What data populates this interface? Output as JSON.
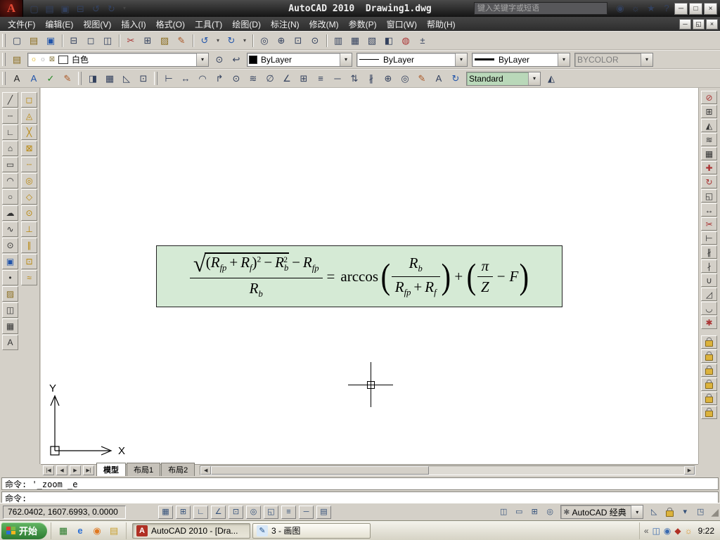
{
  "colors": {
    "titlebar_bg": "#2f2f2f",
    "toolbar_bg": "#d4d0c8",
    "canvas_bg": "#ffffff",
    "formula_bg": "#d5ead5",
    "textstyle_dropdown_bg": "#b9d8b9",
    "start_button_green": "#2c7a32",
    "autocad_logo_red": "#e24a35"
  },
  "ui": {
    "dd_arrow": "▾",
    "scroll_left": "◀",
    "scroll_right": "▶"
  },
  "titlebar": {
    "logo": "A",
    "title": "AutoCAD 2010  Drawing1.dwg",
    "search_placeholder": "键入关键字或短语",
    "quick_icons": [
      {
        "name": "qat-new-icon",
        "glyph": "▢"
      },
      {
        "name": "qat-open-icon",
        "glyph": "▤"
      },
      {
        "name": "qat-save-icon",
        "glyph": "▣"
      },
      {
        "name": "qat-plot-icon",
        "glyph": "⊟"
      },
      {
        "name": "qat-undo-icon",
        "glyph": "↺"
      },
      {
        "name": "qat-redo-icon",
        "glyph": "↻"
      },
      {
        "name": "qat-menu-dropdown",
        "glyph": "▾"
      }
    ],
    "search_icons": [
      {
        "name": "search-binoculars-icon",
        "glyph": "◉"
      },
      {
        "name": "communication-center-icon",
        "glyph": "☼"
      },
      {
        "name": "favorites-star-icon",
        "glyph": "★"
      },
      {
        "name": "help-menu-icon",
        "glyph": "?"
      }
    ],
    "window_buttons": [
      {
        "name": "app-minimize-button",
        "glyph": "─"
      },
      {
        "name": "app-maximize-button",
        "glyph": "□"
      },
      {
        "name": "app-close-button",
        "glyph": "×"
      }
    ]
  },
  "menubar": {
    "items": [
      "文件(F)",
      "编辑(E)",
      "视图(V)",
      "插入(I)",
      "格式(O)",
      "工具(T)",
      "绘图(D)",
      "标注(N)",
      "修改(M)",
      "参数(P)",
      "窗口(W)",
      "帮助(H)"
    ],
    "window_buttons": [
      {
        "name": "doc-minimize-button",
        "glyph": "─"
      },
      {
        "name": "doc-restore-button",
        "glyph": "◱"
      },
      {
        "name": "doc-close-button",
        "glyph": "×"
      }
    ]
  },
  "toolbars": {
    "standard": [
      {
        "name": "qnew-button",
        "glyph": "▢"
      },
      {
        "name": "open-button",
        "glyph": "▤",
        "c": "#8a6d1f"
      },
      {
        "name": "save-button",
        "glyph": "▣",
        "c": "#2255aa"
      },
      {
        "name": "separator",
        "type": "sep",
        "interactable": "false"
      },
      {
        "name": "plot-button",
        "glyph": "⊟"
      },
      {
        "name": "plot-preview-button",
        "glyph": "◻"
      },
      {
        "name": "publish-button",
        "glyph": "◫"
      },
      {
        "name": "separator",
        "type": "sep",
        "interactable": "false"
      },
      {
        "name": "cut-button",
        "glyph": "✂",
        "c": "#aa3333"
      },
      {
        "name": "copy-button",
        "glyph": "⊞"
      },
      {
        "name": "paste-button",
        "glyph": "▨",
        "c": "#8a6d1f"
      },
      {
        "name": "match-properties-button",
        "glyph": "✎",
        "c": "#aa5522"
      },
      {
        "name": "separator",
        "type": "sep",
        "interactable": "false"
      },
      {
        "name": "undo-button",
        "glyph": "↺",
        "c": "#2255aa"
      },
      {
        "name": "undo-dropdown",
        "glyph": "▾"
      },
      {
        "name": "redo-button",
        "glyph": "↻",
        "c": "#2255aa"
      },
      {
        "name": "redo-dropdown",
        "glyph": "▾"
      },
      {
        "name": "separator",
        "type": "sep",
        "interactable": "false"
      },
      {
        "name": "pan-button",
        "glyph": "◎"
      },
      {
        "name": "zoom-realtime-button",
        "glyph": "⊕"
      },
      {
        "name": "zoom-window-button",
        "glyph": "⊡"
      },
      {
        "name": "zoom-previous-button",
        "glyph": "⊙"
      },
      {
        "name": "separator",
        "type": "sep",
        "interactable": "false"
      },
      {
        "name": "properties-button",
        "glyph": "▥"
      },
      {
        "name": "designcenter-button",
        "glyph": "▦"
      },
      {
        "name": "tool-palettes-button",
        "glyph": "▧"
      },
      {
        "name": "sheet-set-manager-button",
        "glyph": "◧"
      },
      {
        "name": "markup-button",
        "glyph": "◍",
        "c": "#aa3333"
      },
      {
        "name": "quickcalc-button",
        "glyph": "±"
      }
    ],
    "layers_pre": [
      {
        "name": "layer-properties-manager-button",
        "glyph": "▤",
        "c": "#8a6d1f"
      }
    ],
    "layer_status": [
      {
        "name": "layer-on-icon",
        "glyph": "☼",
        "c": "#d8a800"
      },
      {
        "name": "layer-freeze-icon",
        "glyph": "☼",
        "c": "#999999"
      },
      {
        "name": "layer-lock-icon",
        "glyph": "⊠",
        "c": "#8a7a40"
      },
      {
        "name": "layer-color-chip",
        "type": "chip",
        "c": "#ffffff"
      }
    ],
    "layer_value": "白色",
    "layers_post": [
      {
        "name": "make-object-layer-current-button",
        "glyph": "⊙"
      },
      {
        "name": "layer-previous-button",
        "glyph": "↩"
      }
    ],
    "properties": {
      "color_chip": "#000000",
      "color_value": "ByLayer",
      "linetype_value": "ByLayer",
      "lineweight_value": "ByLayer",
      "plotstyle_value": "BYCOLOR"
    },
    "styles_icons": [
      {
        "name": "text-style-button",
        "glyph": "A",
        "c": "#222222"
      },
      {
        "name": "single-line-text-button",
        "glyph": "A",
        "c": "#2255aa"
      },
      {
        "name": "spell-check-button",
        "glyph": "✓",
        "c": "#228822"
      },
      {
        "name": "text-edit-button",
        "glyph": "✎",
        "c": "#aa5522"
      }
    ],
    "styles_icons2": [
      {
        "name": "dimension-style-button",
        "glyph": "◨"
      },
      {
        "name": "table-style-button",
        "glyph": "▦"
      },
      {
        "name": "multileader-style-button",
        "glyph": "◺"
      },
      {
        "name": "style-update-button",
        "glyph": "⊡"
      }
    ],
    "dim_icons": [
      {
        "name": "linear-dimension-button",
        "glyph": "⊢"
      },
      {
        "name": "aligned-dimension-button",
        "glyph": "↔"
      },
      {
        "name": "arc-length-button",
        "glyph": "◠"
      },
      {
        "name": "ordinate-button",
        "glyph": "↱"
      },
      {
        "name": "radius-button",
        "glyph": "⊙"
      },
      {
        "name": "jogged-button",
        "glyph": "≋"
      },
      {
        "name": "diameter-button",
        "glyph": "∅"
      },
      {
        "name": "angular-button",
        "glyph": "∠"
      },
      {
        "name": "quick-dimension-button",
        "glyph": "⊞"
      },
      {
        "name": "baseline-button",
        "glyph": "≡"
      },
      {
        "name": "continue-button",
        "glyph": "─"
      },
      {
        "name": "dim-space-button",
        "glyph": "⇅"
      },
      {
        "name": "dim-break-button",
        "glyph": "∦"
      },
      {
        "name": "tolerance-button",
        "glyph": "⊕"
      },
      {
        "name": "center-mark-button",
        "glyph": "◎"
      },
      {
        "name": "dim-edit-button",
        "glyph": "✎",
        "c": "#aa5522"
      },
      {
        "name": "dim-text-edit-button",
        "glyph": "A"
      },
      {
        "name": "dim-update-button",
        "glyph": "↻",
        "c": "#2255aa"
      }
    ],
    "textstyle_value": "Standard",
    "dim_post": [
      {
        "name": "dimension-style-manager-button",
        "glyph": "◭"
      }
    ]
  },
  "palettes": {
    "draw": [
      {
        "name": "line-button",
        "glyph": "╱"
      },
      {
        "name": "construction-line-button",
        "glyph": "┄"
      },
      {
        "name": "polyline-button",
        "glyph": "∟"
      },
      {
        "name": "polygon-button",
        "glyph": "⌂"
      },
      {
        "name": "rectangle-button",
        "glyph": "▭"
      },
      {
        "name": "arc-button",
        "glyph": "◠"
      },
      {
        "name": "circle-button",
        "glyph": "○"
      },
      {
        "name": "revision-cloud-button",
        "glyph": "☁"
      },
      {
        "name": "spline-button",
        "glyph": "∿"
      },
      {
        "name": "ellipse-button",
        "glyph": "⊙"
      },
      {
        "name": "insert-block-button",
        "glyph": "▣",
        "c": "#2255aa"
      },
      {
        "name": "point-button",
        "glyph": "•"
      },
      {
        "name": "hatch-button",
        "glyph": "▨",
        "c": "#8a6d1f"
      },
      {
        "name": "region-button",
        "glyph": "◫"
      },
      {
        "name": "table-button",
        "glyph": "▦"
      },
      {
        "name": "multiline-text-button",
        "glyph": "A"
      }
    ],
    "osnap": [
      {
        "name": "snap-to-endpoint-button",
        "glyph": "◻",
        "c": "#b8860b"
      },
      {
        "name": "snap-to-midpoint-button",
        "glyph": "◬",
        "c": "#b8860b"
      },
      {
        "name": "snap-to-intersection-button",
        "glyph": "╳",
        "c": "#b8860b"
      },
      {
        "name": "snap-to-apparent-intersection-button",
        "glyph": "⊠",
        "c": "#b8860b"
      },
      {
        "name": "snap-to-extension-button",
        "glyph": "┄",
        "c": "#b8860b"
      },
      {
        "name": "snap-to-center-button",
        "glyph": "◎",
        "c": "#b8860b"
      },
      {
        "name": "snap-to-quadrant-button",
        "glyph": "◇",
        "c": "#b8860b"
      },
      {
        "name": "snap-to-tangent-button",
        "glyph": "⊙",
        "c": "#b8860b"
      },
      {
        "name": "snap-to-perpendicular-button",
        "glyph": "⊥",
        "c": "#b8860b"
      },
      {
        "name": "snap-to-parallel-button",
        "glyph": "∥",
        "c": "#b8860b"
      },
      {
        "name": "snap-to-node-button",
        "glyph": "⊡",
        "c": "#b8860b"
      },
      {
        "name": "snap-to-nearest-button",
        "glyph": "≈",
        "c": "#b8860b"
      }
    ],
    "modify": [
      {
        "name": "erase-button",
        "glyph": "⊘",
        "c": "#aa3333"
      },
      {
        "name": "copy-object-button",
        "glyph": "⊞"
      },
      {
        "name": "mirror-button",
        "glyph": "◭"
      },
      {
        "name": "offset-button",
        "glyph": "≋"
      },
      {
        "name": "array-button",
        "glyph": "▦"
      },
      {
        "name": "move-button",
        "glyph": "✚",
        "c": "#aa3333"
      },
      {
        "name": "rotate-button",
        "glyph": "↻",
        "c": "#aa3333"
      },
      {
        "name": "scale-button",
        "glyph": "◱"
      },
      {
        "name": "stretch-button",
        "glyph": "↔"
      },
      {
        "name": "trim-button",
        "glyph": "✂",
        "c": "#aa3333"
      },
      {
        "name": "extend-button",
        "glyph": "⊢"
      },
      {
        "name": "break-at-point-button",
        "glyph": "∦"
      },
      {
        "name": "break-button",
        "glyph": "∤"
      },
      {
        "name": "join-button",
        "glyph": "∪"
      },
      {
        "name": "chamfer-button",
        "glyph": "◿"
      },
      {
        "name": "fillet-button",
        "glyph": "◡"
      },
      {
        "name": "explode-button",
        "glyph": "✱",
        "c": "#aa3333"
      }
    ],
    "locks": [
      {
        "name": "padlock-icon",
        "type": "lock"
      },
      {
        "name": "padlock-icon",
        "type": "lock"
      },
      {
        "name": "padlock-icon",
        "type": "lock"
      },
      {
        "name": "padlock-icon",
        "type": "lock"
      },
      {
        "name": "padlock-icon",
        "type": "lock"
      },
      {
        "name": "padlock-icon",
        "type": "lock"
      }
    ]
  },
  "canvas": {
    "x_label": "X",
    "y_label": "Y"
  },
  "formula": {
    "text": "(√((R_fp+R_f)²−R_b²)−R_fp)/R_b = arccos(R_b/(R_fp+R_f)) + (π/Z − F)",
    "sqrt": "√",
    "lp": "(",
    "rp": ")",
    "R": "R",
    "sub_fp": "fp",
    "sub_f": "f",
    "sub_b": "b",
    "sup2": "2",
    "plus": "+",
    "minus": "−",
    "eq": "=",
    "arccos": "arccos",
    "pi": "π",
    "Z": "Z",
    "F": "F"
  },
  "layout_tabs": {
    "nav": [
      {
        "name": "first-tab-button",
        "glyph": "|◀"
      },
      {
        "name": "prev-tab-button",
        "glyph": "◀"
      },
      {
        "name": "next-tab-button",
        "glyph": "▶"
      },
      {
        "name": "last-tab-button",
        "glyph": "▶|"
      }
    ],
    "tabs": [
      {
        "label": "模型",
        "active": "true"
      },
      {
        "label": "布局1"
      },
      {
        "label": "布局2"
      }
    ]
  },
  "command": {
    "line1": "命令: '_zoom _e",
    "line2": "命令:"
  },
  "statusbar": {
    "coords": "762.0402, 1607.6993, 0.0000",
    "toggles": [
      {
        "name": "snap-toggle",
        "glyph": "▦"
      },
      {
        "name": "grid-toggle",
        "glyph": "⊞"
      },
      {
        "name": "ortho-toggle",
        "glyph": "∟"
      },
      {
        "name": "polar-toggle",
        "glyph": "∠"
      },
      {
        "name": "osnap-toggle",
        "glyph": "⊡"
      },
      {
        "name": "otrack-toggle",
        "glyph": "◎"
      },
      {
        "name": "ducs-toggle",
        "glyph": "◱"
      },
      {
        "name": "dyn-toggle",
        "glyph": "≡"
      },
      {
        "name": "lwt-toggle",
        "glyph": "─"
      },
      {
        "name": "qp-toggle",
        "glyph": "▤"
      }
    ],
    "right_icons_a": [
      {
        "name": "model-space-button",
        "glyph": "◫"
      },
      {
        "name": "quick-view-layouts-button",
        "glyph": "▭"
      },
      {
        "name": "quick-view-drawings-button",
        "glyph": "⊞"
      },
      {
        "name": "navigation-button",
        "glyph": "◎"
      }
    ],
    "workspace_icon": "✱",
    "workspace": "AutoCAD 经典",
    "right_icons_b": [
      {
        "name": "annotation-scale-button",
        "glyph": "◺"
      },
      {
        "name": "toolbar-lock-icon",
        "type": "lock"
      },
      {
        "name": "status-menu-arrow-icon",
        "glyph": "▾"
      },
      {
        "name": "clean-screen-button",
        "glyph": "◳"
      }
    ],
    "corner_grip": "◢"
  },
  "taskbar": {
    "start_label": "开始",
    "quick_launch": [
      {
        "name": "show-desktop-icon",
        "glyph": "▦",
        "c": "#2a7a2a"
      },
      {
        "name": "internet-explorer-icon",
        "glyph": "e",
        "c": "#2a6fd6"
      },
      {
        "name": "media-player-icon",
        "glyph": "◉",
        "c": "#e07820"
      },
      {
        "name": "folder-icon",
        "glyph": "▤",
        "c": "#c8a032"
      }
    ],
    "tasks": [
      {
        "name": "taskbar-item-autocad",
        "label": "AutoCAD 2010 - [Dra...",
        "icon": "A",
        "icon_bg": "#b03024",
        "icon_c": "#ffffff",
        "active": "true"
      },
      {
        "name": "taskbar-item-paint",
        "label": "3 - 画图",
        "icon": "✎",
        "icon_bg": "#d8e8f8",
        "icon_c": "#20508a"
      }
    ],
    "tray_icons": [
      {
        "name": "tray-collapse-chevron-icon",
        "glyph": "«",
        "c": "#555555"
      },
      {
        "name": "tray-network-icon",
        "glyph": "◫",
        "c": "#3a6ab0"
      },
      {
        "name": "tray-volume-icon",
        "glyph": "◉",
        "c": "#3a6ab0"
      },
      {
        "name": "tray-autocad-icon",
        "glyph": "◆",
        "c": "#b03024"
      },
      {
        "name": "tray-security-icon",
        "glyph": "☼",
        "c": "#d89020"
      }
    ],
    "clock": "9:22"
  }
}
